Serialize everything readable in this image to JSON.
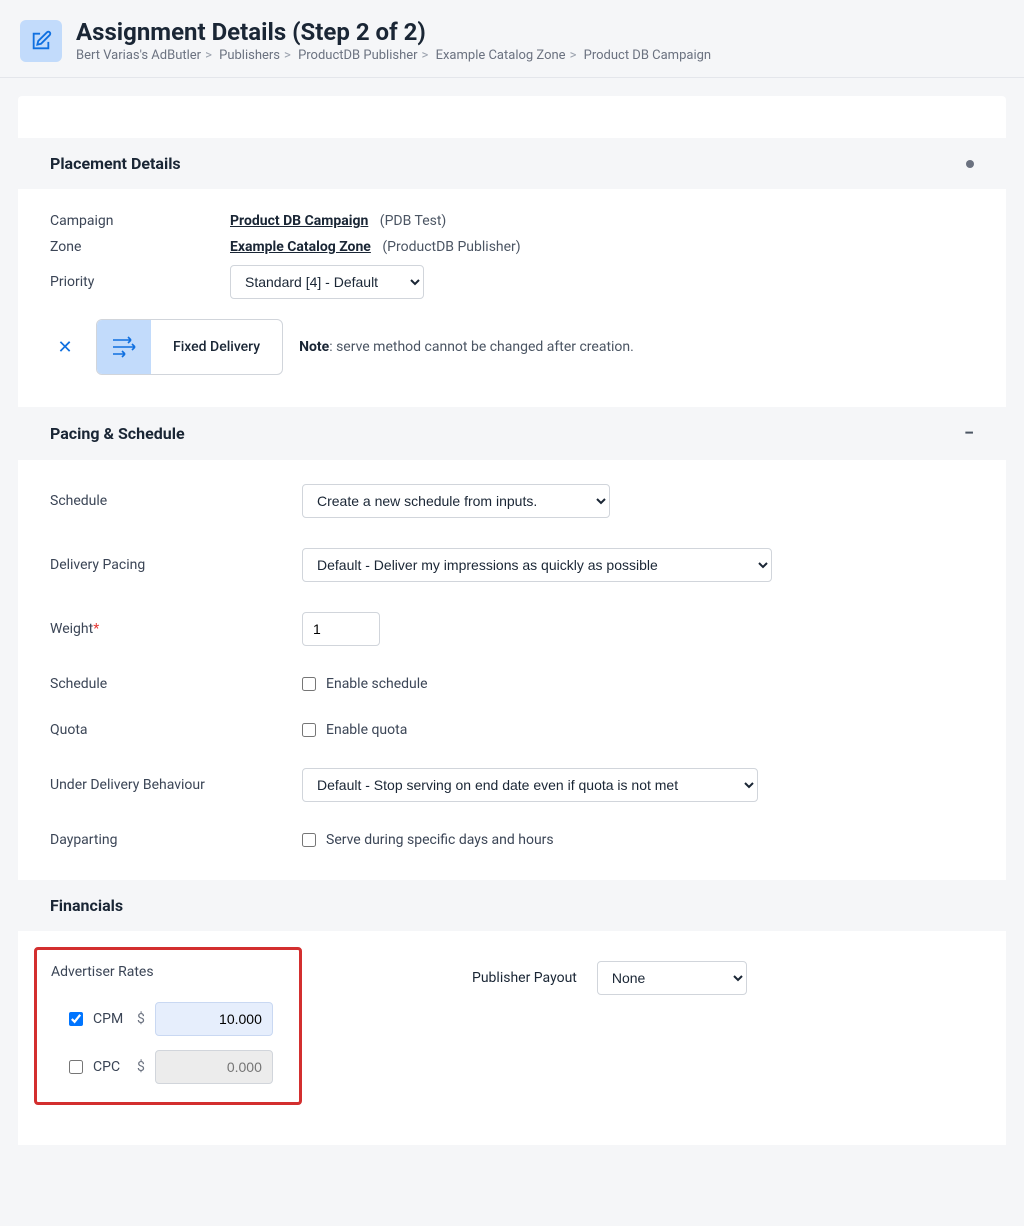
{
  "header": {
    "title": "Assignment Details (Step 2 of 2)",
    "breadcrumb": [
      "Bert Varias's AdButler",
      "Publishers",
      "ProductDB Publisher",
      "Example Catalog Zone",
      "Product DB Campaign"
    ]
  },
  "placement": {
    "section_title": "Placement Details",
    "campaign_label": "Campaign",
    "campaign_link": "Product DB Campaign",
    "campaign_paren": "(PDB Test)",
    "zone_label": "Zone",
    "zone_link": "Example Catalog Zone",
    "zone_paren": "(ProductDB Publisher)",
    "priority_label": "Priority",
    "priority_value": "Standard [4] - Default",
    "delivery_label": "Fixed Delivery",
    "note_prefix": "Note",
    "note_text": ": serve method cannot be changed after creation."
  },
  "pacing": {
    "section_title": "Pacing & Schedule",
    "schedule_label": "Schedule",
    "schedule_value": "Create a new schedule from inputs.",
    "delivery_pacing_label": "Delivery Pacing",
    "delivery_pacing_value": "Default - Deliver my impressions as quickly as possible",
    "weight_label": "Weight",
    "weight_value": "1",
    "schedule2_label": "Schedule",
    "schedule2_check": "Enable schedule",
    "quota_label": "Quota",
    "quota_check": "Enable quota",
    "udb_label": "Under Delivery Behaviour",
    "udb_value": "Default - Stop serving on end date even if quota is not met",
    "dayparting_label": "Dayparting",
    "dayparting_check": "Serve during specific days and hours"
  },
  "financials": {
    "section_title": "Financials",
    "advertiser_rates_title": "Advertiser Rates",
    "cpm_label": "CPM",
    "cpm_currency": "$",
    "cpm_value": "10.000",
    "cpc_label": "CPC",
    "cpc_currency": "$",
    "cpc_placeholder": "0.000",
    "publisher_payout_label": "Publisher Payout",
    "publisher_payout_value": "None"
  }
}
